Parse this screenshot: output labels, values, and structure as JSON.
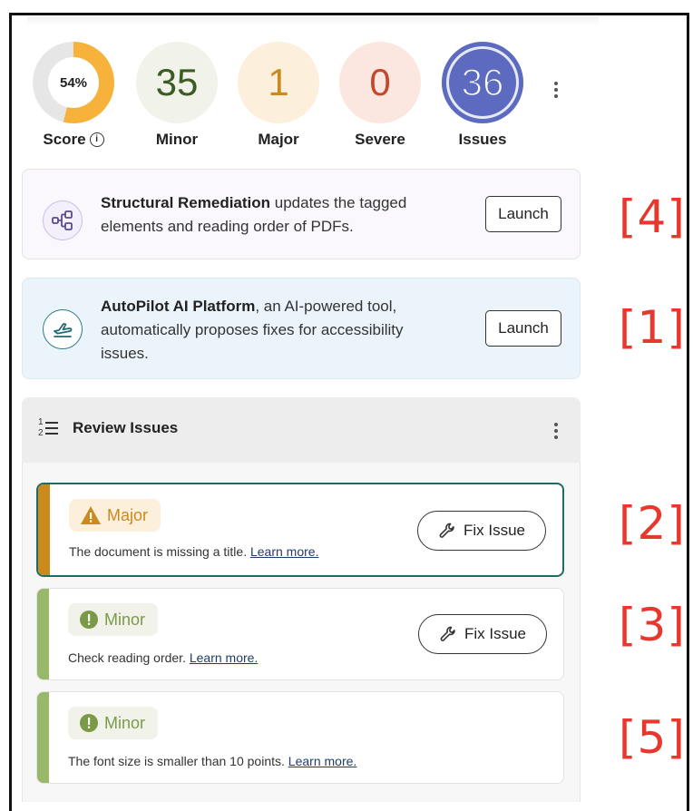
{
  "score": {
    "value_label": "54%",
    "fraction": 0.54,
    "label": "Score",
    "info_glyph": "i",
    "ring_color": "#f7b23b",
    "track_color": "#e6e6e6"
  },
  "metrics": [
    {
      "id": "minor",
      "value": "35",
      "label": "Minor",
      "color": "#3b5d23",
      "bg": "#f1f3ea"
    },
    {
      "id": "major",
      "value": "1",
      "label": "Major",
      "color": "#c98a1e",
      "bg": "#fcefdc"
    },
    {
      "id": "severe",
      "value": "0",
      "label": "Severe",
      "color": "#c24a2a",
      "bg": "#fbe7e0"
    },
    {
      "id": "issues",
      "value": "36",
      "label": "Issues",
      "color": "#5c6bc0",
      "bg": "#e6e9f8"
    }
  ],
  "cards": {
    "structural": {
      "bold": "Structural Remediation",
      "line1_rest": " updates the tagged",
      "line2": "elements and reading order of PDFs.",
      "button": "Launch",
      "marker": "[4]"
    },
    "autopilot": {
      "bold": "AutoPilot AI Platform",
      "line1_rest": ", an AI-powered tool,",
      "line2": "automatically proposes fixes for accessibility",
      "line3": "issues.",
      "button": "Launch",
      "marker": "[1]"
    }
  },
  "review": {
    "title": "Review Issues",
    "list_glyph_top": "1",
    "list_glyph_bottom": "2"
  },
  "issues": [
    {
      "severity": "Major",
      "description": "The document is missing a title. ",
      "link": "Learn more.",
      "button": "Fix Issue",
      "marker": "[2]",
      "stripe_color": "#c98a1e",
      "badge_bg": "#fcefdc",
      "badge_color": "#c98a1e",
      "icon": "warning-triangle-icon"
    },
    {
      "severity": "Minor",
      "description": "Check reading order. ",
      "link": "Learn more.",
      "button": "Fix Issue",
      "marker": "[3]",
      "stripe_color": "#9ab86a",
      "badge_bg": "#f1f3ea",
      "badge_color": "#7a9a48",
      "icon": "exclamation-circle-icon"
    },
    {
      "severity": "Minor",
      "description": "The font size is smaller than 10 points. ",
      "link": "Learn more.",
      "marker": "[5]",
      "stripe_color": "#9ab86a",
      "badge_bg": "#f1f3ea",
      "badge_color": "#7a9a48",
      "icon": "exclamation-circle-icon"
    }
  ]
}
